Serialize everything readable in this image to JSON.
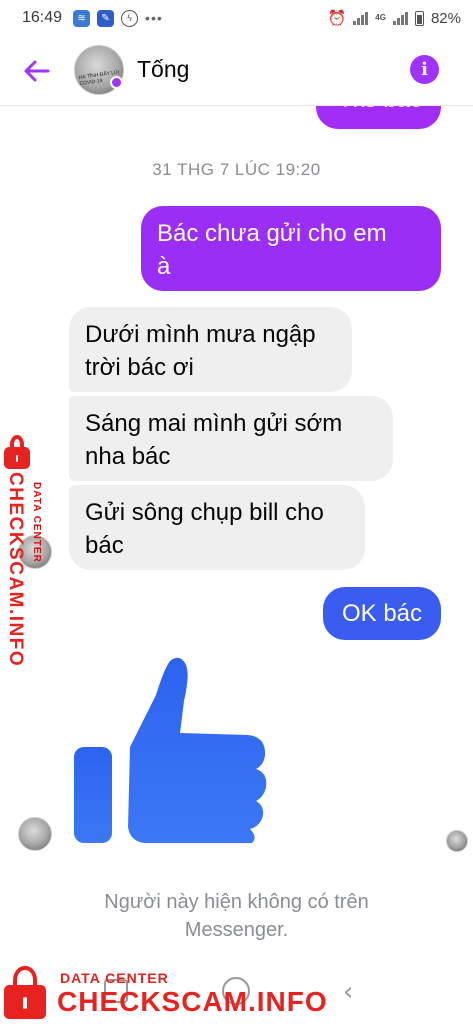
{
  "status_bar": {
    "time": "16:49",
    "battery": "82%",
    "network": "4G"
  },
  "header": {
    "contact_name": "Tống",
    "avatar_caption": "HÀ TĨNH ĐẨY LÙI COVID-19",
    "info_symbol": "i"
  },
  "messages": {
    "partial_outgoing": "Tks bác",
    "timestamp": "31 THG 7 LÚC 19:20",
    "outgoing_1_line1": "Bác chưa gửi cho em",
    "outgoing_1_line2": "à",
    "incoming_1_line1": "Dưới mình mưa ngập",
    "incoming_1_line2": "trời bác ơi",
    "incoming_2_line1": "Sáng mai mình gửi sớm",
    "incoming_2_line2": "nha bác",
    "incoming_3_line1": "Gửi sông chụp bill cho",
    "incoming_3_line2": "bác",
    "outgoing_2": "OK bác",
    "sticker": "thumbs-up"
  },
  "footer": {
    "unavailable_line1": "Người này hiện không có trên",
    "unavailable_line2": "Messenger."
  },
  "watermark": {
    "small": "DATA CENTER",
    "big": "CHECKSCAM.INFO"
  },
  "colors": {
    "accent_purple": "#a033ff",
    "bubble_purple": "#9b2ef4",
    "bubble_blue": "#3b5cf0",
    "incoming_bg": "#efefef",
    "thumb_blue": "#2f6bf2",
    "watermark_red": "#e8231f"
  }
}
